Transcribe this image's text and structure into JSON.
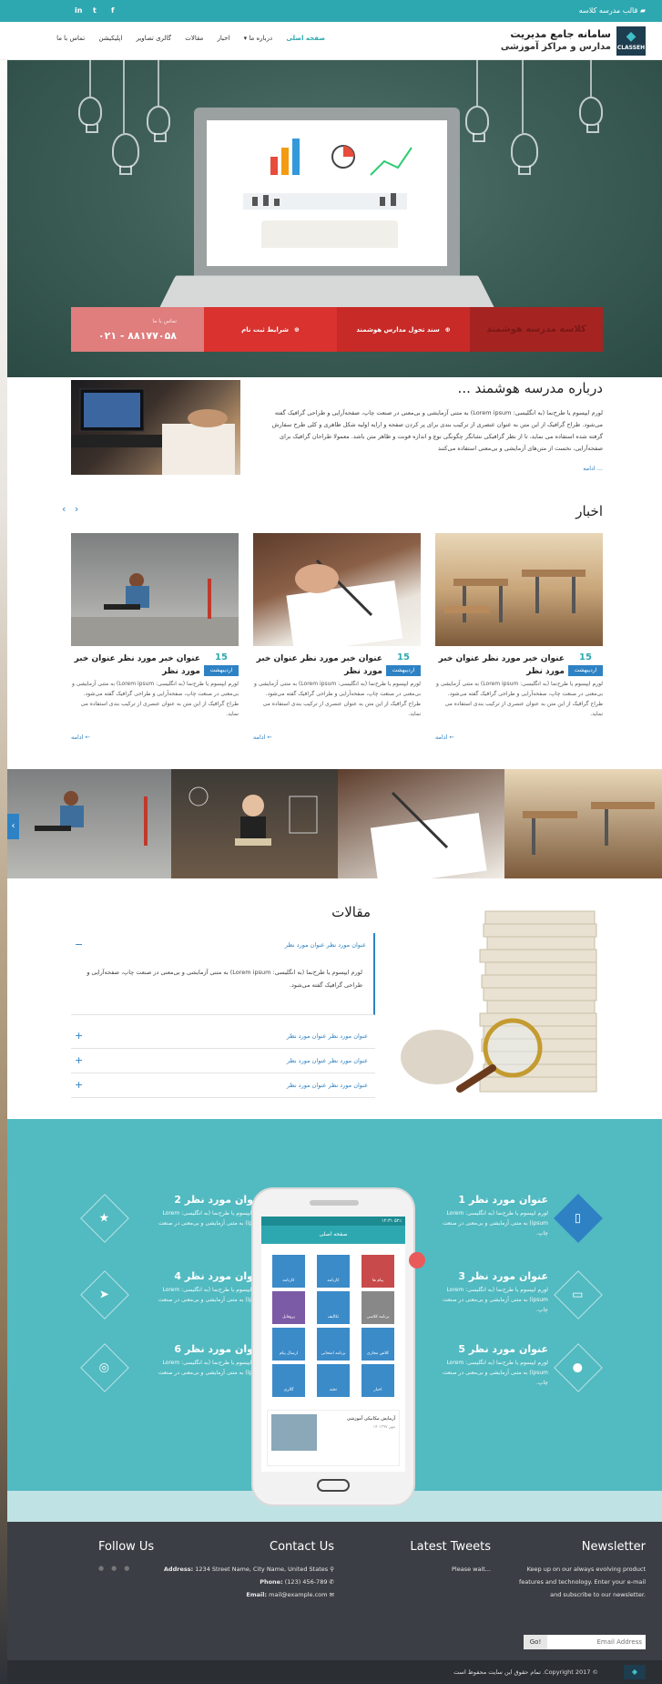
{
  "topbar": {
    "title": "قالب مدرسه کلاسه",
    "social": [
      "f",
      "t",
      "in"
    ]
  },
  "logo": {
    "line1": "سامانه جامع مدیریت",
    "line2": "مدارس و مراکز آموزشی",
    "brand": "CLASSEH"
  },
  "menu": {
    "items": [
      {
        "label": "صفحه اصلی",
        "active": true
      },
      {
        "label": "درباره ما ▾",
        "active": false
      },
      {
        "label": "اخبار",
        "active": false
      },
      {
        "label": "مقالات",
        "active": false
      },
      {
        "label": "گالری تصاویر",
        "active": false
      },
      {
        "label": "اپلیکیشن",
        "active": false
      },
      {
        "label": "تماس با ما",
        "active": false
      }
    ]
  },
  "cta": {
    "phone_label": "تماس با ما",
    "phone": "۰۲۱ - ۸۸۱۷۷۰۵۸",
    "register": "شرایط ثبت نام",
    "manifest": "سند تحول مدارس هوشمند",
    "smart": "کلاسه مدرسه هوشمند",
    "colors": {
      "phone": "#e07d7d",
      "register": "#d9322f",
      "manifest": "#c72a27",
      "smart": "#a52421"
    }
  },
  "about": {
    "title": "درباره مدرسه هوشمند ...",
    "text": "لورم ایپسوم یا طرح‌نما (به انگلیسی: Lorem ipsum) به متنی آزمایشی و بی‌معنی در صنعت چاپ، صفحه‌آرایی و طراحی گرافیک گفته می‌شود. طراح گرافیک از این متن به عنوان عنصری از ترکیب بندی برای پر کردن صفحه و ارایه اولیه شکل ظاهری و کلی طرح سفارش گرفته شده استفاده می نماید، تا از نظر گرافیکی نشانگر چگونگی نوع و اندازه فونت و ظاهر متن باشد. معمولا طراحان گرافیک برای صفحه‌آرایی، نخست از متن‌های آزمایشی و بی‌معنی استفاده می‌کنند",
    "more": "ادامه ..."
  },
  "news": {
    "title": "اخبار",
    "arrows": "‹ ›",
    "items": [
      {
        "day": "15",
        "month": "اردیبهشت",
        "title": "عنوان خبر مورد نظر عنوان خبر مورد نظر",
        "text": "لورم ایپسوم یا طرح‌نما (به انگلیسی: Lorem ipsum) به متنی آزمایشی و بی‌معنی در صنعت چاپ، صفحه‌آرایی و طراحی گرافیک گفته می‌شود. طراح گرافیک از این متن به عنوان عنصری از ترکیب بندی استفاده می نماید.",
        "more": "ادامه ←"
      },
      {
        "day": "15",
        "month": "اردیبهشت",
        "title": "عنوان خبر مورد نظر عنوان خبر مورد نظر",
        "text": "لورم ایپسوم یا طرح‌نما (به انگلیسی: Lorem ipsum) به متنی آزمایشی و بی‌معنی در صنعت چاپ، صفحه‌آرایی و طراحی گرافیک گفته می‌شود. طراح گرافیک از این متن به عنوان عنصری از ترکیب بندی استفاده می نماید.",
        "more": "ادامه ←"
      },
      {
        "day": "15",
        "month": "اردیبهشت",
        "title": "عنوان خبر مورد نظر عنوان خبر مورد نظر",
        "text": "لورم ایپسوم یا طرح‌نما (به انگلیسی: Lorem ipsum) به متنی آزمایشی و بی‌معنی در صنعت چاپ، صفحه‌آرایی و طراحی گرافیک گفته می‌شود. طراح گرافیک از این متن به عنوان عنصری از ترکیب بندی استفاده می نماید.",
        "more": "ادامه ←"
      }
    ]
  },
  "articles": {
    "title": "مقالات",
    "open": {
      "label": "عنوان مورد نظر عنوان مورد نظر",
      "body": "لورم ایپسوم یا طرح‌نما (به انگلیسی: Lorem ipsum) به متنی آزمایشی و بی‌معنی در صنعت چاپ، صفحه‌آرایی و طراحی گرافیک گفته می‌شود."
    },
    "closed": [
      "عنوان مورد نظر عنوان مورد نظر",
      "عنوان مورد نظر عنوان مورد نظر",
      "عنوان مورد نظر عنوان مورد نظر"
    ]
  },
  "features": {
    "desc": "لورم ایپسوم یا طرح‌نما (به انگلیسی: Lorem ipsum) به متنی آزمایشی و بی‌معنی در صنعت چاپ.",
    "items": [
      {
        "title": "عنوان مورد نظر 1",
        "icon": "phone-icon"
      },
      {
        "title": "عنوان مورد نظر 2",
        "icon": "star-icon"
      },
      {
        "title": "عنوان مورد نظر 3",
        "icon": "laptop-icon"
      },
      {
        "title": "عنوان مورد نظر 4",
        "icon": "paper-plane-icon"
      },
      {
        "title": "عنوان مورد نظر 5",
        "icon": "apple-icon"
      },
      {
        "title": "عنوان مورد نظر 6",
        "icon": "globe-icon"
      }
    ]
  },
  "phone": {
    "statusbar": "۱۲:۳۱ ۵۲٪",
    "appbar": "صفحه اصلی",
    "tiles": [
      "کارنامه",
      "کارنامه",
      "پیام ها",
      "پروفایل",
      "تکالیف",
      "برنامه کلاسی",
      "ارسال پیام",
      "برنامه امتحانی",
      "کلاس مجازی",
      "گالری",
      "تخته",
      "اخبار"
    ],
    "post_title": "آزمایش مکانیکی آموزشی",
    "post_date": "۱۴ مهر ۱۳۹۷"
  },
  "footer": {
    "newsletter": {
      "title": "Newsletter",
      "text": "Keep up on our always evolving product features and technology. Enter your e-mail and subscribe to our newsletter.",
      "placeholder": "Email Address",
      "button": "Go!"
    },
    "tweets": {
      "title": "Latest Tweets",
      "text": "Please wait..."
    },
    "contact": {
      "title": "Contact Us",
      "address_label": "Address:",
      "address": "1234 Street Name, City Name, United States",
      "phone_label": "Phone:",
      "phone": "(123) 456-789",
      "email_label": "Email:",
      "email": "mail@example.com"
    },
    "follow": {
      "title": "Follow Us"
    }
  },
  "copyright": "© Copyright 2017. تمام حقوق این سایت محفوظ است",
  "colors": {
    "accent": "#2ea8b0",
    "link": "#2e82c4",
    "features_bg": "#52bac1",
    "footer_bg": "#3b3e44"
  }
}
